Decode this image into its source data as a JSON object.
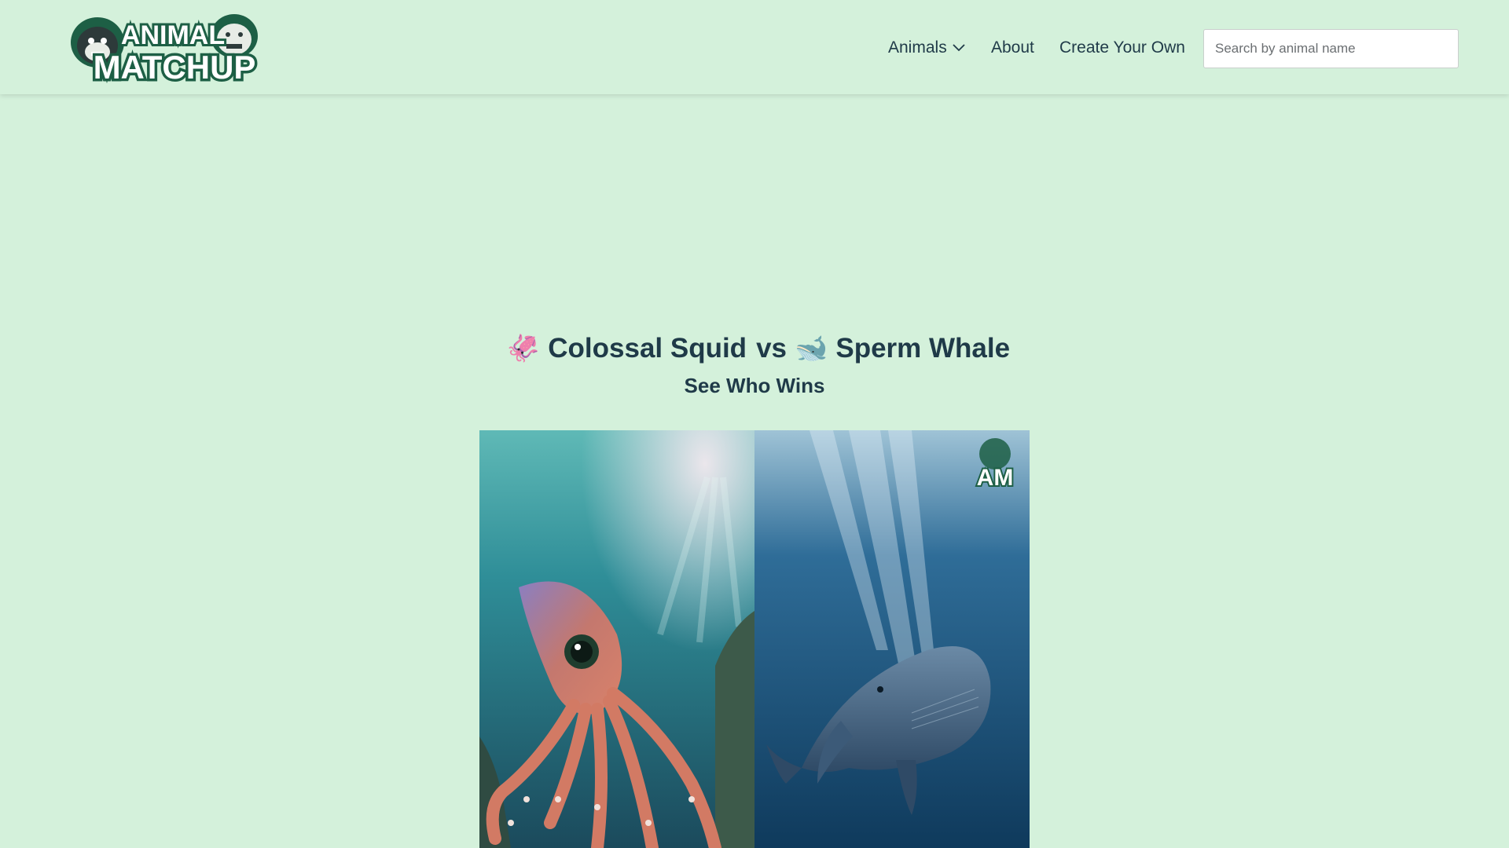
{
  "brand": {
    "logo_text_top": "ANIMAL",
    "logo_text_bottom": "MATCHUP"
  },
  "nav": {
    "animals_label": "Animals",
    "about_label": "About",
    "create_label": "Create Your Own",
    "search_placeholder": "Search by animal name",
    "search_value": ""
  },
  "matchup": {
    "fighter_a": {
      "emoji": "🦑",
      "name": "Colossal Squid"
    },
    "versus": "vs",
    "fighter_b": {
      "emoji": "🐋",
      "name": "Sperm Whale"
    },
    "subtitle": "See Who Wins",
    "watermark": "AM"
  },
  "icons": {
    "dropdown": "chevron-down-icon"
  },
  "colors": {
    "background": "#d4f1db",
    "text": "#1f3a48",
    "logo_green": "#1e6b4a"
  }
}
